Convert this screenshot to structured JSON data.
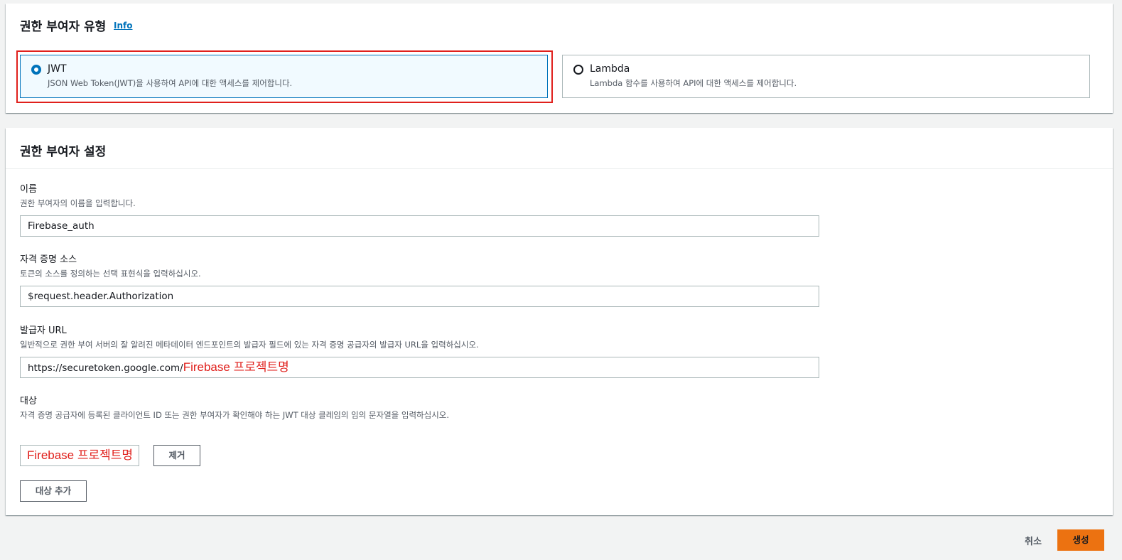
{
  "authorizer_type": {
    "title": "권한 부여자 유형",
    "info_link": "Info",
    "options": [
      {
        "label": "JWT",
        "description": "JSON Web Token(JWT)을 사용하여 API에 대한 액세스를 제어합니다.",
        "selected": true
      },
      {
        "label": "Lambda",
        "description": "Lambda 함수를 사용하여 API에 대한 액세스를 제어합니다.",
        "selected": false
      }
    ]
  },
  "authorizer_settings": {
    "title": "권한 부여자 설정",
    "name": {
      "label": "이름",
      "description": "권한 부여자의 이름을 입력합니다.",
      "value": "Firebase_auth"
    },
    "identity_source": {
      "label": "자격 증명 소스",
      "description": "토큰의 소스를 정의하는 선택 표현식을 입력하십시오.",
      "value": "$request.header.Authorization"
    },
    "issuer_url": {
      "label": "발급자 URL",
      "description": "일반적으로 권한 부여 서버의 잘 알려진 메타데이터 엔드포인트의 발급자 필드에 있는 자격 증명 공급자의 발급자 URL을 입력하십시오.",
      "value": "https://securetoken.google.com/",
      "annotation": "Firebase 프로젝트명"
    },
    "audience": {
      "label": "대상",
      "description": "자격 증명 공급자에 등록된 클라이언트 ID 또는 권한 부여자가 확인해야 하는 JWT 대상 클레임의 임의 문자열을 입력하십시오.",
      "value": "Firebase 프로젝트명",
      "remove_label": "제거",
      "add_label": "대상 추가"
    }
  },
  "footer": {
    "cancel_label": "취소",
    "create_label": "생성"
  },
  "colors": {
    "accent": "#0073bb",
    "primary_button": "#ec7211",
    "annotation": "#e0201c"
  }
}
